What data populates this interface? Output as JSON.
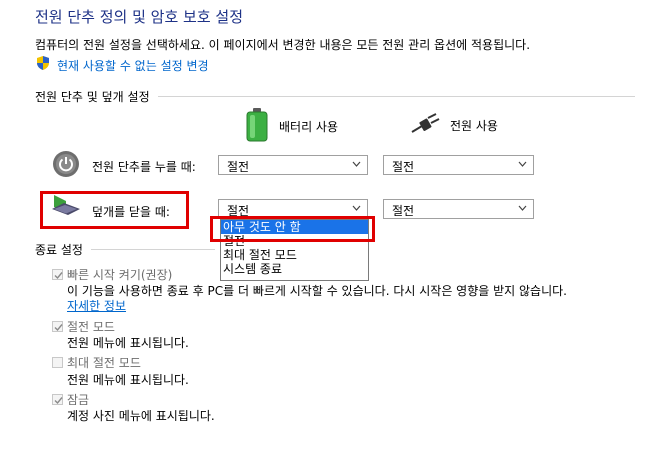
{
  "header": {
    "title": "전원 단추 정의 및 암호 보호 설정",
    "description": "컴퓨터의 전원 설정을 선택하세요. 이 페이지에서 변경한 내용은 모든 전원 관리 옵션에 적용됩니다.",
    "change_link": "현재 사용할 수 없는 설정 변경"
  },
  "power_section": {
    "heading": "전원 단추 및 덮개 설정",
    "battery_label": "배터리 사용",
    "plugged_label": "전원 사용",
    "rows": [
      {
        "label": "전원 단추를 누를 때:",
        "battery_value": "절전",
        "plugged_value": "절전"
      },
      {
        "label": "덮개를 닫을 때:",
        "battery_value": "절전",
        "plugged_value": "절전"
      }
    ],
    "dropdown_options": [
      "아무 것도 안 함",
      "절전",
      "최대 절전 모드",
      "시스템 종료"
    ]
  },
  "shutdown_section": {
    "heading": "종료 설정",
    "items": [
      {
        "label": "빠른 시작 켜기(권장)",
        "checked": true,
        "desc": "이 기능을 사용하면 종료 후 PC를 더 빠르게 시작할 수 있습니다. 다시 시작은 영향을 받지 않습니다.",
        "link": "자세한 정보"
      },
      {
        "label": "절전 모드",
        "checked": true,
        "desc": "전원 메뉴에 표시됩니다."
      },
      {
        "label": "최대 절전 모드",
        "checked": false,
        "desc": "전원 메뉴에 표시됩니다."
      },
      {
        "label": "잠금",
        "checked": true,
        "desc": "계정 사진 메뉴에 표시됩니다."
      }
    ]
  },
  "colors": {
    "title": "#1e3287",
    "link": "#0066cc",
    "highlight": "#e00000",
    "selection": "#1a73e8"
  }
}
